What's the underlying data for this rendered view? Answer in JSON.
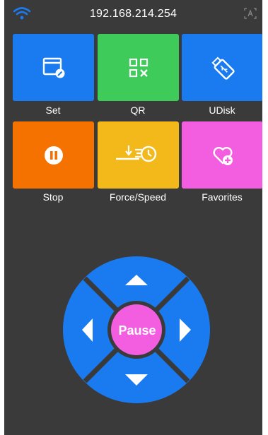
{
  "status_bar": {
    "ip_address": "192.168.214.254",
    "wifi_icon": "wifi-icon",
    "screenshot_icon": "screenshot-icon"
  },
  "tiles": [
    {
      "label": "Set",
      "icon": "settings-window-icon",
      "color": "#1a7bf0"
    },
    {
      "label": "QR",
      "icon": "qr-code-icon",
      "color": "#3ecb5a"
    },
    {
      "label": "UDisk",
      "icon": "usb-drive-icon",
      "color": "#1a7bf0"
    },
    {
      "label": "Stop",
      "icon": "pause-circle-icon",
      "color": "#f57200"
    },
    {
      "label": "Force/Speed",
      "icon": "force-speed-icon",
      "color": "#f3b819"
    },
    {
      "label": "Favorites",
      "icon": "heart-plus-icon",
      "color": "#f35ee0"
    }
  ],
  "dpad": {
    "center_label": "Pause",
    "pad_color": "#1a7bf0",
    "center_color": "#f35ee0",
    "up_icon": "arrow-up-icon",
    "down_icon": "arrow-down-icon",
    "left_icon": "arrow-left-icon",
    "right_icon": "arrow-right-icon"
  }
}
